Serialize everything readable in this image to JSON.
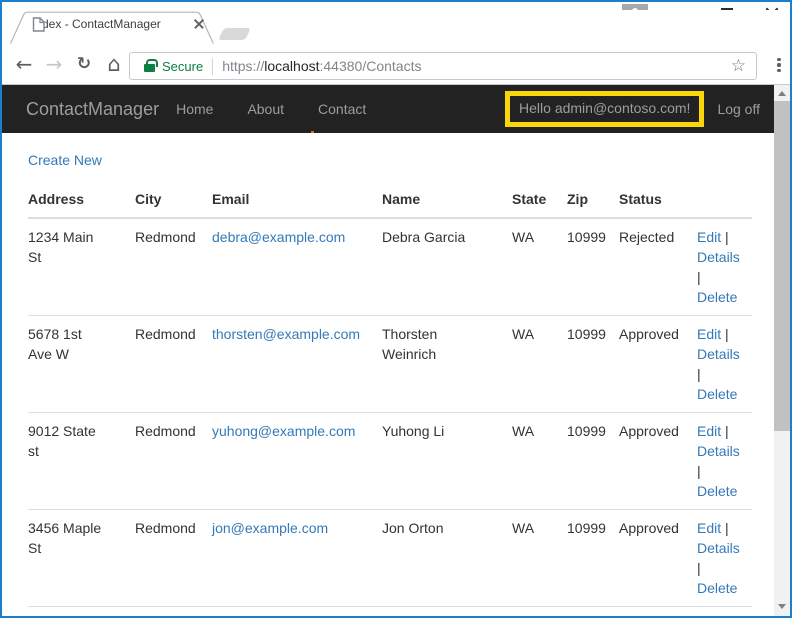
{
  "browser": {
    "tab_title": "Index - ContactManager",
    "toolbar_icons": {
      "back": "←",
      "forward": "→",
      "reload": "↻",
      "home": "⌂",
      "bookmark": "☆"
    },
    "omnibox": {
      "security_label": "Secure",
      "scheme": "https://",
      "host": "localhost",
      "path": ":44380/Contacts"
    }
  },
  "navbar": {
    "brand": "ContactManager",
    "links": [
      "Home",
      "About",
      "Contact"
    ],
    "greeting": "Hello admin@contoso.com!",
    "log_off": "Log off"
  },
  "page": {
    "create_new": "Create New"
  },
  "table": {
    "headers": [
      "Address",
      "City",
      "Email",
      "Name",
      "State",
      "Zip",
      "Status"
    ],
    "actions": {
      "edit": "Edit",
      "details": "Details",
      "delete": "Delete",
      "separator": "|"
    },
    "rows": [
      {
        "address": [
          "1234 Main",
          "St"
        ],
        "city": "Redmond",
        "email": "debra@example.com",
        "name": [
          "Debra Garcia"
        ],
        "state": "WA",
        "zip": "10999",
        "status": "Rejected"
      },
      {
        "address": [
          "5678 1st",
          "Ave W"
        ],
        "city": "Redmond",
        "email": "thorsten@example.com",
        "name": [
          "Thorsten",
          "Weinrich"
        ],
        "state": "WA",
        "zip": "10999",
        "status": "Approved"
      },
      {
        "address": [
          "9012 State",
          "st"
        ],
        "city": "Redmond",
        "email": "yuhong@example.com",
        "name": [
          "Yuhong Li"
        ],
        "state": "WA",
        "zip": "10999",
        "status": "Approved"
      },
      {
        "address": [
          "3456 Maple",
          "St"
        ],
        "city": "Redmond",
        "email": "jon@example.com",
        "name": [
          "Jon Orton"
        ],
        "state": "WA",
        "zip": "10999",
        "status": "Approved"
      }
    ]
  },
  "colors": {
    "window_border": "#1b7fd0",
    "navbar_bg": "#222222",
    "navbar_text": "#9d9d9d",
    "highlight_yellow": "#f8d60a",
    "link_blue": "#337ab7",
    "secure_green": "#0b8043"
  }
}
